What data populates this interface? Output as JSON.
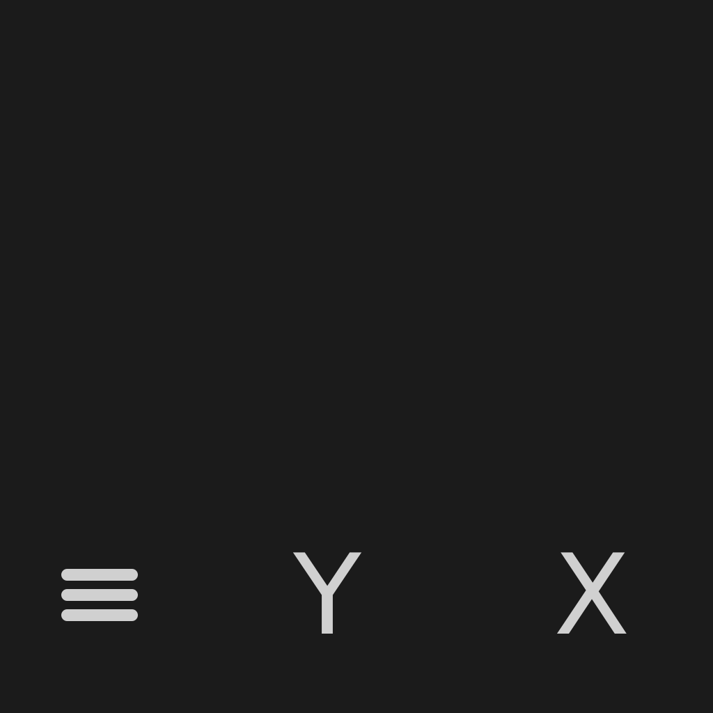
{
  "colors": {
    "background": "#1b1b1b",
    "foreground": "#d0d0d0"
  },
  "toolbar": {
    "menu_icon": "hamburger-menu-icon",
    "key_y_label": "Y",
    "key_x_label": "X"
  }
}
